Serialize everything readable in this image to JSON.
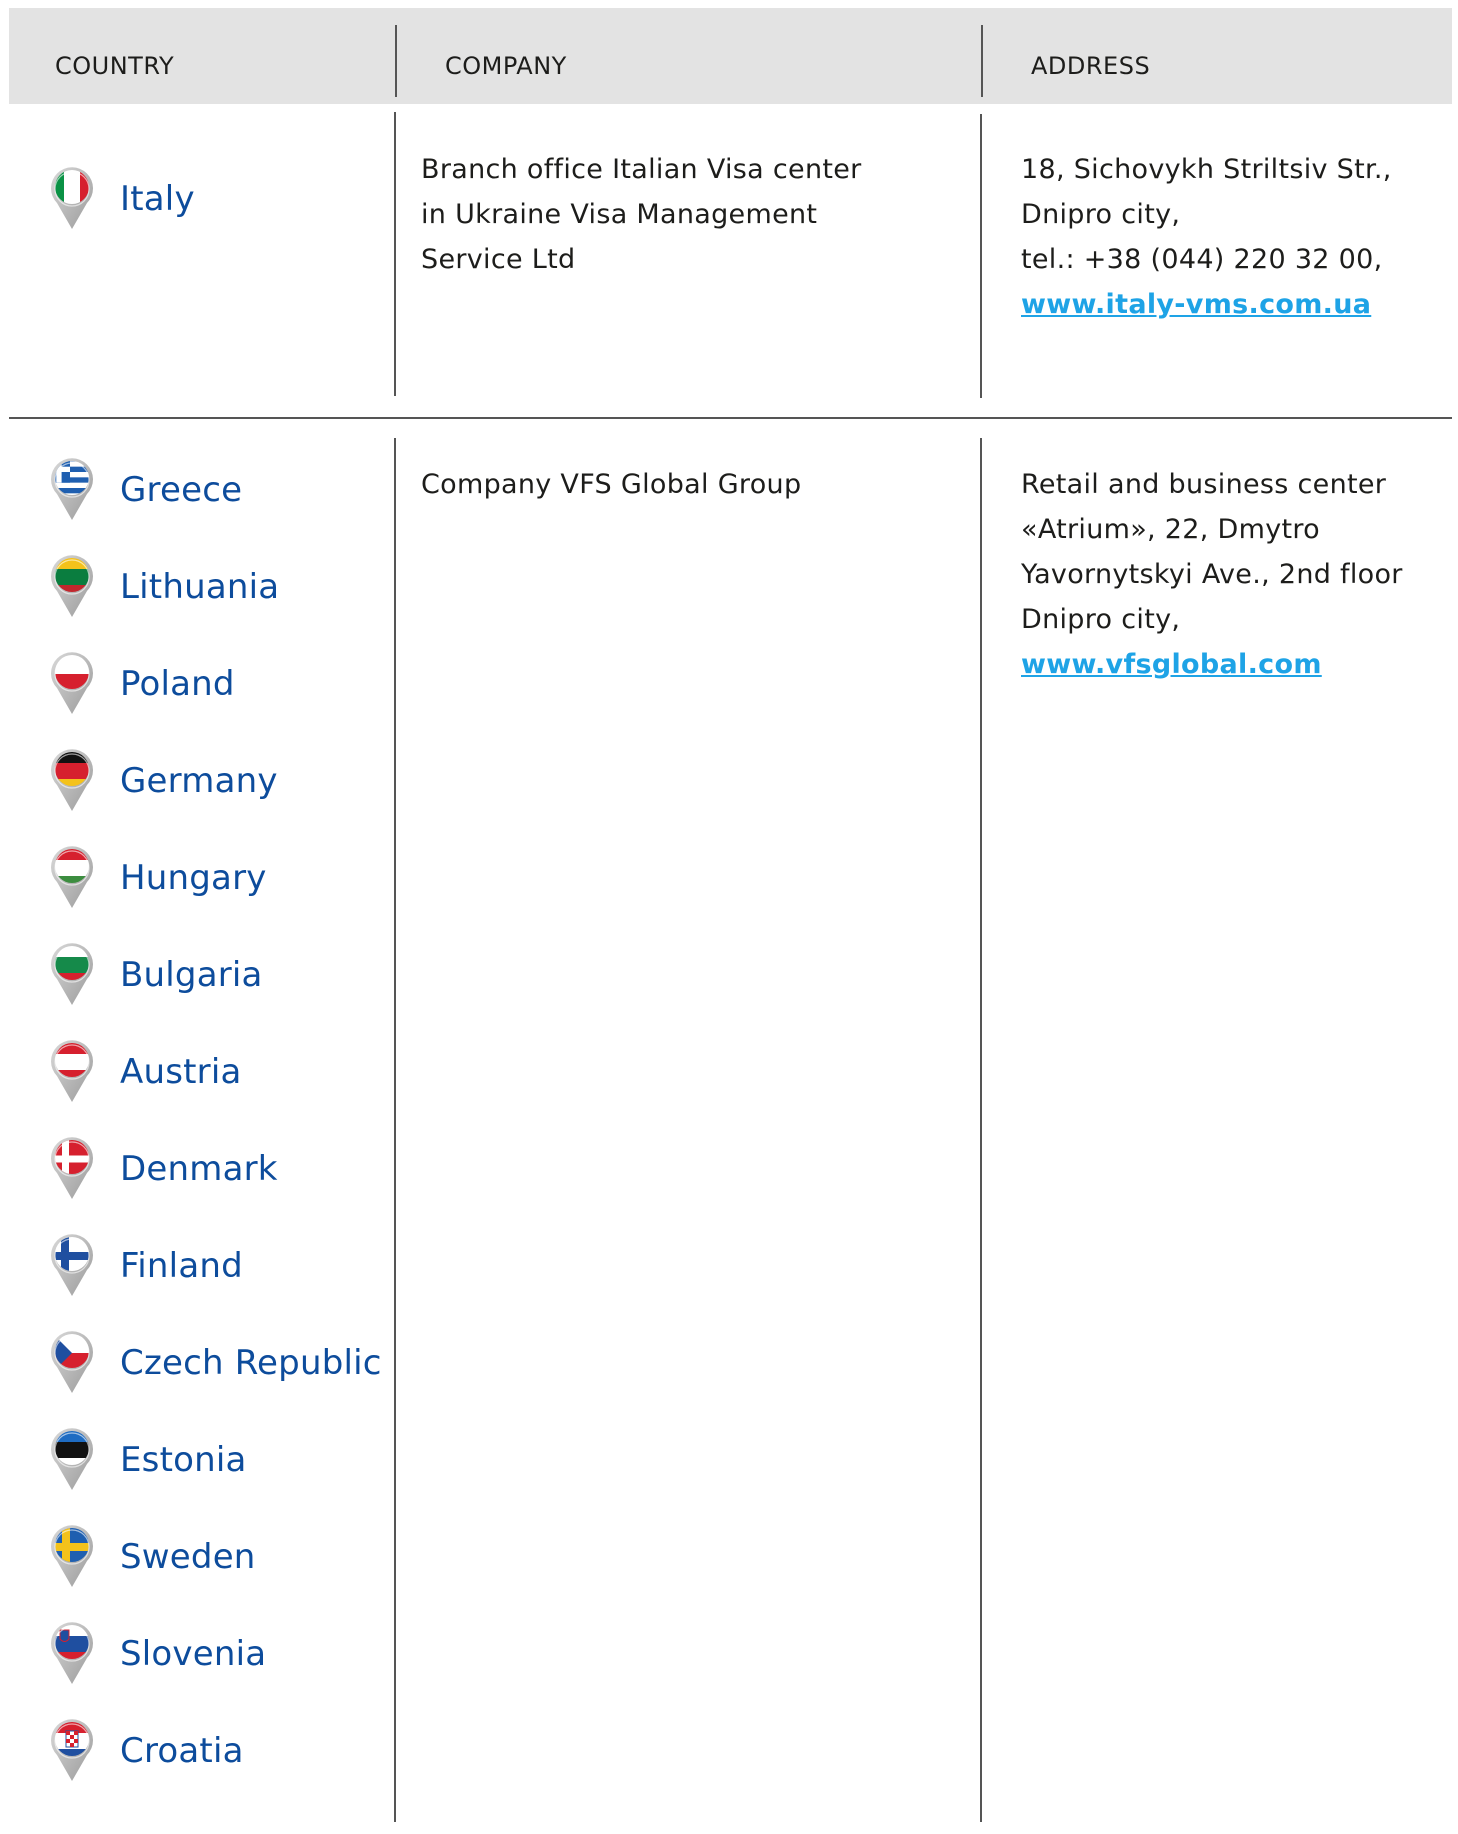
{
  "header": {
    "country": "COUNTRY",
    "company": "COMPANY",
    "address": "ADDRESS"
  },
  "rows": [
    {
      "countries": [
        {
          "name": "Italy",
          "flag": "italy-flag"
        }
      ],
      "company": [
        "Branch office Italian Visa center",
        "in Ukraine Visa Management",
        "Service Ltd"
      ],
      "address": [
        "18, Sichovykh Striltsiv Str.,",
        "Dnipro city,",
        "tel.: +38 (044) 220 32 00,"
      ],
      "link": "www.italy-vms.com.ua"
    },
    {
      "countries": [
        {
          "name": "Greece",
          "flag": "greece-flag"
        },
        {
          "name": "Lithuania",
          "flag": "lithuania-flag"
        },
        {
          "name": "Poland",
          "flag": "poland-flag"
        },
        {
          "name": "Germany",
          "flag": "germany-flag"
        },
        {
          "name": "Hungary",
          "flag": "hungary-flag"
        },
        {
          "name": "Bulgaria",
          "flag": "bulgaria-flag"
        },
        {
          "name": "Austria",
          "flag": "austria-flag"
        },
        {
          "name": "Denmark",
          "flag": "denmark-flag"
        },
        {
          "name": "Finland",
          "flag": "finland-flag"
        },
        {
          "name": "Czech Republic",
          "flag": "czech-flag"
        },
        {
          "name": "Estonia",
          "flag": "estonia-flag"
        },
        {
          "name": "Sweden",
          "flag": "sweden-flag"
        },
        {
          "name": "Slovenia",
          "flag": "slovenia-flag"
        },
        {
          "name": "Croatia",
          "flag": "croatia-flag"
        }
      ],
      "company": [
        "Company VFS Global Group"
      ],
      "address": [
        "Retail and business center",
        "«Atrium», 22, Dmytro",
        "Yavornytskyi Ave., 2nd floor",
        "Dnipro city,"
      ],
      "link": "www.vfsglobal.com"
    }
  ],
  "colors": {
    "country_text": "#0d4c9c",
    "link": "#1ea3e6",
    "header_bg": "#e3e3e3"
  }
}
